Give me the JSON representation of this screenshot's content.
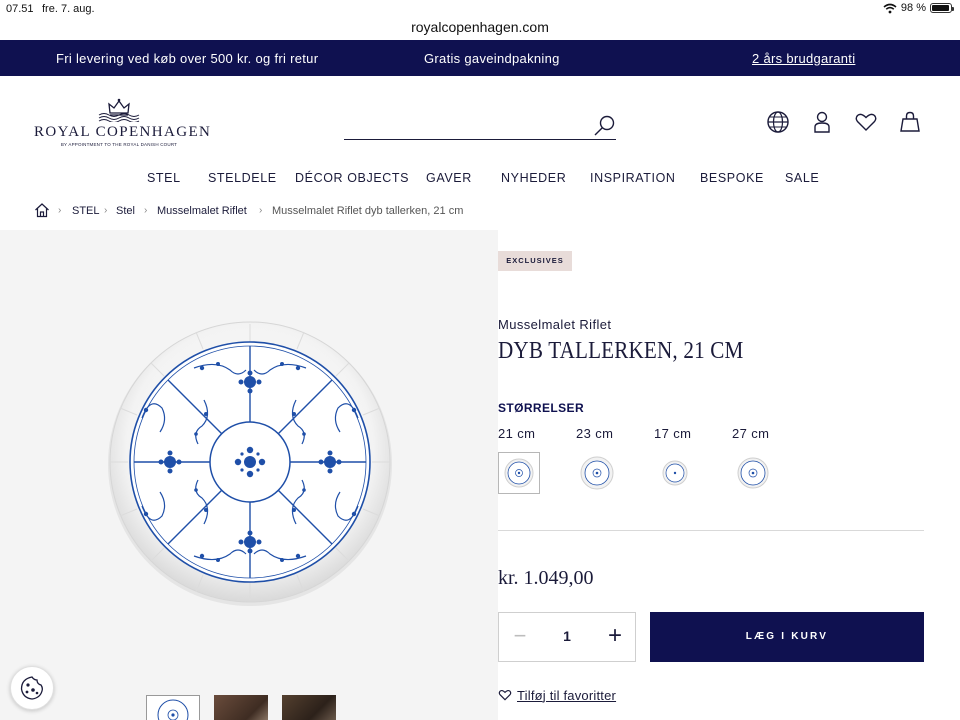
{
  "status_bar": {
    "time": "07.51",
    "date": "fre. 7. aug.",
    "battery": "98 %"
  },
  "browser": {
    "url": "royalcopenhagen.com"
  },
  "promo": {
    "delivery": "Fri levering ved køb over 500 kr. og fri retur",
    "gift_wrap": "Gratis gaveindpakning",
    "guarantee": "2 års brudgaranti"
  },
  "logo": {
    "brand": "ROYAL COPENHAGEN",
    "appointment": "BY APPOINTMENT TO THE ROYAL DANISH COURT"
  },
  "search": {
    "value": "",
    "placeholder": ""
  },
  "icons": {
    "globe": "globe-icon",
    "account": "user-icon",
    "favorites": "heart-icon",
    "cart": "bag-icon",
    "search": "search-icon",
    "home": "home-icon",
    "cookie": "cookie-icon"
  },
  "nav": [
    "STEL",
    "STELDELE",
    "DÉCOR OBJECTS",
    "GAVER",
    "NYHEDER",
    "INSPIRATION",
    "BESPOKE",
    "SALE"
  ],
  "breadcrumb": [
    "STEL",
    "Stel",
    "Musselmalet Riflet",
    "Musselmalet Riflet dyb tallerken, 21 cm"
  ],
  "product": {
    "badge": "EXCLUSIVES",
    "collection": "Musselmalet Riflet",
    "title": "DYB TALLERKEN, 21 CM",
    "sizes_heading": "STØRRELSER",
    "sizes": [
      "21 cm",
      "23 cm",
      "17 cm",
      "27 cm"
    ],
    "selected_size": "21 cm",
    "price": "kr. 1.049,00",
    "quantity": "1",
    "minus": "−",
    "plus": "+",
    "add_to_cart": "LÆG I KURV",
    "favorite": "Tilføj til favoritter"
  },
  "colors": {
    "brand_navy": "#0f1150",
    "badge_bg": "#e8dcd9",
    "plate_blue": "#1f4fa8"
  }
}
